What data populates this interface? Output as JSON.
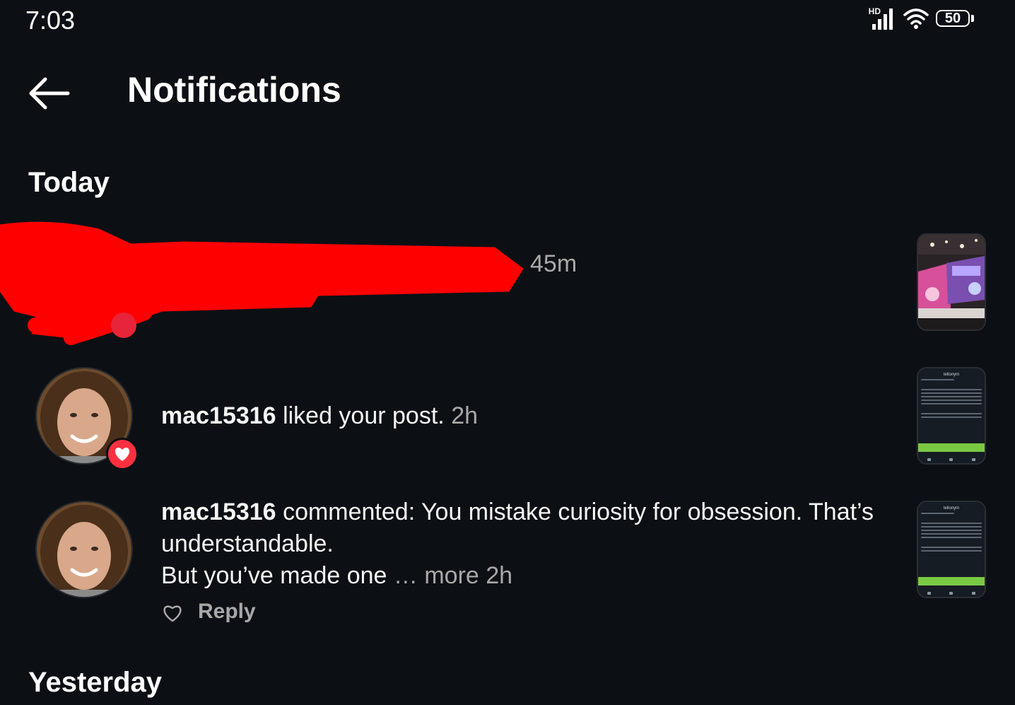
{
  "status_bar": {
    "time": "7:03",
    "network_label": "HD",
    "battery": "50",
    "icons": [
      "signal-icon",
      "wifi-icon",
      "battery-icon"
    ]
  },
  "header": {
    "title": "Notifications",
    "back_icon": "arrow-left-icon"
  },
  "sections": {
    "today": "Today",
    "yesterday": "Yesterday"
  },
  "notifications": [
    {
      "redacted": true,
      "time": "45m",
      "thumbnail": "photo-thumbnail"
    },
    {
      "username": "mac15316",
      "action": "liked your post.",
      "time": "2h",
      "badge": "heart-icon",
      "thumbnail": "post-thumbnail"
    },
    {
      "username": "mac15316",
      "action": "commented: You mistake curiosity for obsession. That’s understandable.",
      "action_line2": "But you’ve made one",
      "more": "… more",
      "time": "2h",
      "reply_label": "Reply",
      "thumbnail": "post-thumbnail"
    }
  ],
  "thumbnail_post": {
    "app_label": "tellonym"
  },
  "colors": {
    "background": "#0c1014",
    "text": "#f5f5f5",
    "muted": "#a8a8a8",
    "like_red": "#ff3040",
    "redaction": "#ff0000"
  }
}
